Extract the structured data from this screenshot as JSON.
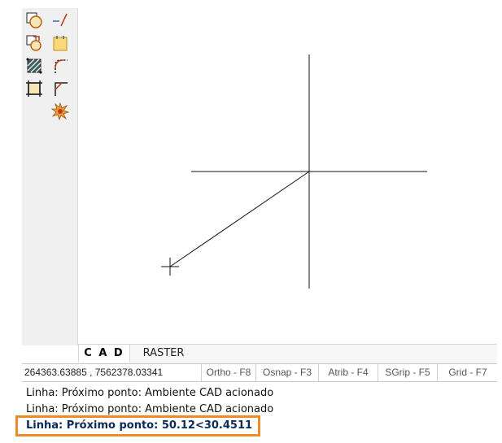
{
  "toolbar": {
    "tools": [
      {
        "name": "ellipse-square-icon"
      },
      {
        "name": "line-segment-icon"
      },
      {
        "name": "rotate-circle-icon"
      },
      {
        "name": "note-icon"
      },
      {
        "name": "hatch-square-icon"
      },
      {
        "name": "fillet-icon"
      },
      {
        "name": "trim-square-icon"
      },
      {
        "name": "chamfer-icon"
      },
      {
        "name": "explode-icon"
      }
    ]
  },
  "tabs": {
    "cad": "C A D",
    "raster": "RASTER"
  },
  "status": {
    "coords": "264363.63885 , 7562378.03341",
    "toggles": [
      "Ortho - F8",
      "Osnap - F3",
      "Atrib - F4",
      "SGrip - F5",
      "Grid - F7"
    ]
  },
  "commands": {
    "history": [
      "Linha: Próximo ponto: Ambiente CAD acionado",
      "Linha: Próximo ponto: Ambiente CAD acionado"
    ],
    "current": "Linha: Próximo ponto: 50.12<30.4511"
  },
  "colors": {
    "accent": "#f08a24",
    "command_text": "#0b2a55"
  }
}
